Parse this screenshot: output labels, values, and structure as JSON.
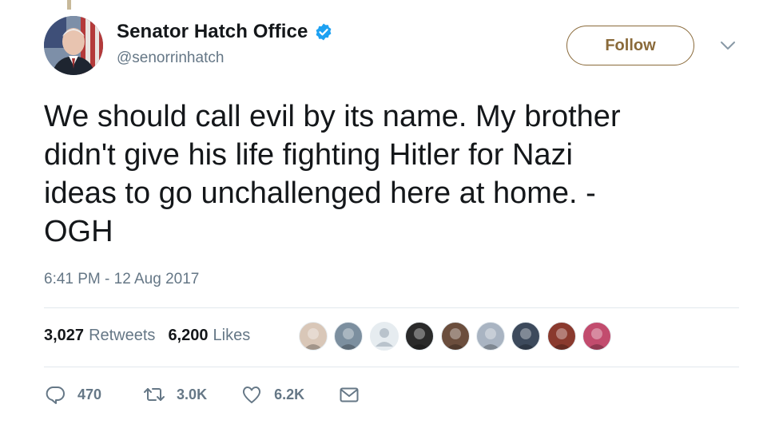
{
  "account": {
    "display_name": "Senator Hatch Office",
    "handle": "@senorrinhatch",
    "verified": true
  },
  "follow_button": {
    "label": "Follow",
    "color": "#8a6a3a"
  },
  "tweet": {
    "text": "We should call evil by its name. My brother\ndidn't give his life fighting Hitler for Nazi\nideas to go unchallenged here at home. -\nOGH",
    "timestamp": "6:41 PM - 12 Aug 2017"
  },
  "stats": {
    "retweets_count": "3,027",
    "retweets_label": "Retweets",
    "likes_count": "6,200",
    "likes_label": "Likes"
  },
  "likers": [
    {
      "icon": "liker-avatar",
      "color": "#d9c7b8"
    },
    {
      "icon": "liker-avatar",
      "color": "#7c8f9f"
    },
    {
      "icon": "default-avatar",
      "color": "#b9c3cc"
    },
    {
      "icon": "liker-avatar",
      "color": "#2a2a2a"
    },
    {
      "icon": "liker-avatar",
      "color": "#6b4e3d"
    },
    {
      "icon": "liker-avatar",
      "color": "#a9b4c2"
    },
    {
      "icon": "liker-avatar",
      "color": "#3d4a5c"
    },
    {
      "icon": "liker-avatar",
      "color": "#8a3a2e"
    },
    {
      "icon": "liker-avatar",
      "color": "#c24c6e"
    }
  ],
  "actions": {
    "reply_count": "470",
    "retweet_count": "3.0K",
    "like_count": "6.2K"
  },
  "colors": {
    "text_primary": "#14171a",
    "text_secondary": "#657786",
    "verified_blue": "#1da1f2",
    "divider": "#e1e8ed"
  }
}
